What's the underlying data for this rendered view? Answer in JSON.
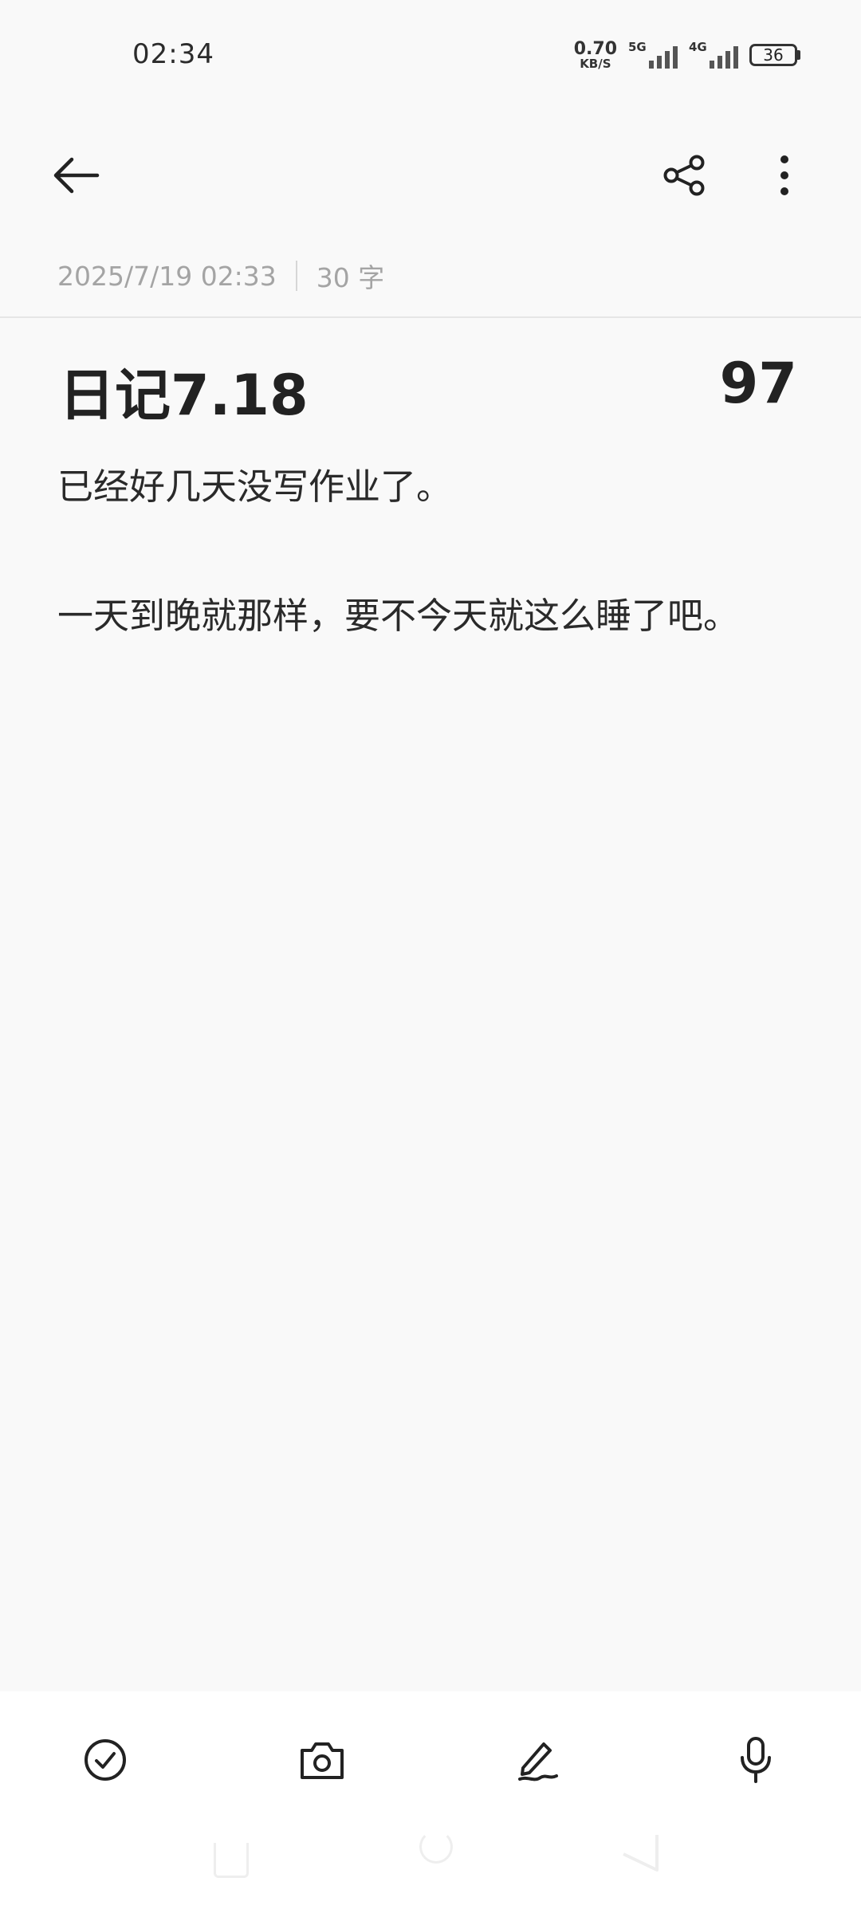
{
  "status_bar": {
    "time": "02:34",
    "net_speed_value": "0.70",
    "net_speed_unit": "KB/S",
    "sim1_type": "5G",
    "sim2_type": "4G",
    "battery_level": "36"
  },
  "toolbar": {
    "back_icon": "arrow-left-icon",
    "share_icon": "share-icon",
    "more_icon": "more-vertical-icon"
  },
  "meta": {
    "datetime": "2025/7/19 02:33",
    "word_count": "30 字"
  },
  "note": {
    "title": "日记7.18",
    "number": "97",
    "lines": [
      "已经好几天没写作业了。",
      "一天到晚就那样，要不今天就这么睡了吧。"
    ]
  },
  "bottom_tools": {
    "icons": [
      "checklist-icon",
      "camera-icon",
      "pen-icon",
      "microphone-icon"
    ]
  },
  "colors": {
    "background": "#f9f9f9",
    "text_primary": "#222222",
    "text_meta": "#a4a4a4",
    "bottom_bar": "#ffffff"
  }
}
